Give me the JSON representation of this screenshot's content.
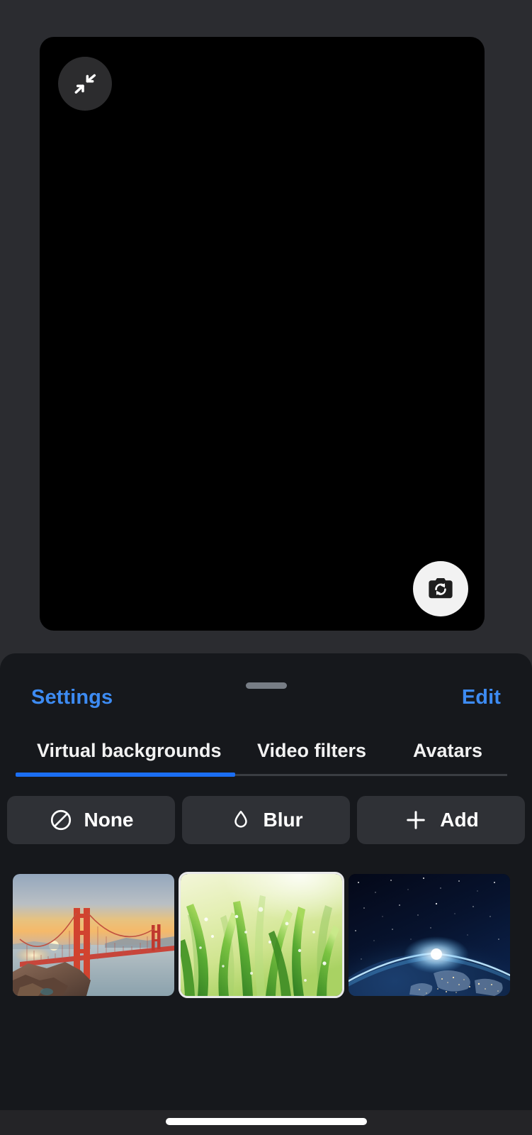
{
  "app": {
    "background_color": "#2b2c30",
    "sheet_color": "#16181c",
    "accent_color": "#3d8bf2",
    "indicator_color": "#1b6ef3"
  },
  "video_preview": {
    "name": "self-view-preview",
    "background_color": "#000000",
    "collapse_button": {
      "icon": "collapse-arrows-icon",
      "tooltip": "Minimize"
    },
    "flip_camera_button": {
      "icon": "switch-camera-icon",
      "tooltip": "Switch camera"
    }
  },
  "sheet": {
    "settings_label": "Settings",
    "edit_label": "Edit",
    "drag_handle": "drag-handle"
  },
  "tabs": {
    "selected_index": 0,
    "items": [
      {
        "label": "Virtual backgrounds",
        "selected": true
      },
      {
        "label": "Video filters",
        "selected": false
      },
      {
        "label": "Avatars",
        "selected": false
      }
    ]
  },
  "options": [
    {
      "label": "None",
      "icon": "no-background-icon"
    },
    {
      "label": "Blur",
      "icon": "droplet-icon"
    },
    {
      "label": "Add",
      "icon": "plus-icon"
    }
  ],
  "backgrounds": [
    {
      "name": "golden-gate-bridge",
      "alt": "Golden Gate Bridge at sunset",
      "selected": false
    },
    {
      "name": "dewy-grass",
      "alt": "Green grass with dew drops",
      "selected": true
    },
    {
      "name": "earth-from-space",
      "alt": "Earth from space at night",
      "selected": false
    }
  ],
  "system": {
    "home_indicator": "home-indicator"
  }
}
